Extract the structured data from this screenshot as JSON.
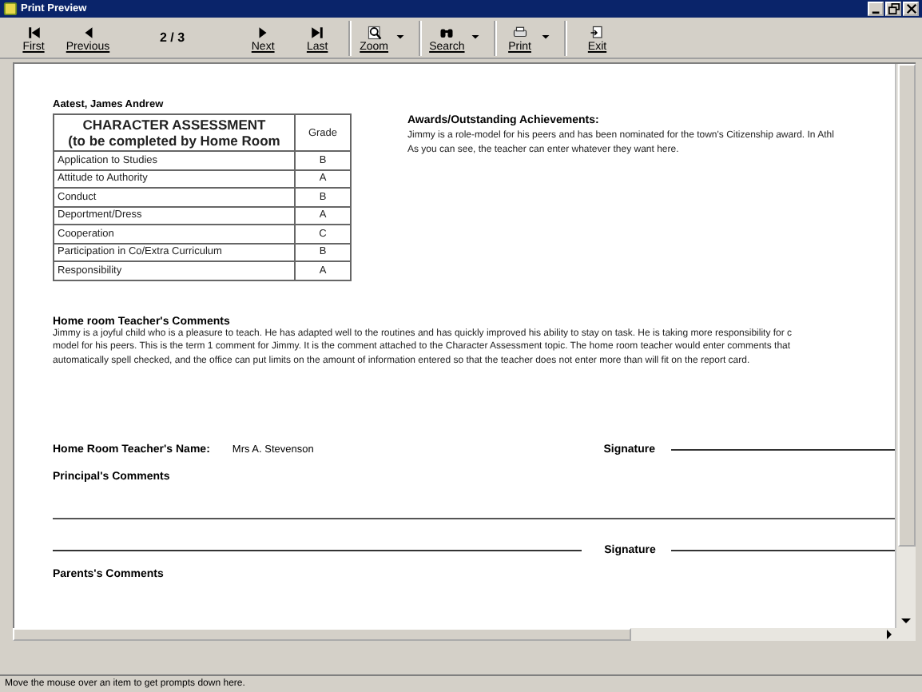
{
  "window": {
    "title": "Print Preview"
  },
  "toolbar": [
    {
      "kind": "first",
      "label": "First"
    },
    {
      "kind": "previous",
      "label": "Previous"
    },
    {
      "kind": "page",
      "label": "2 / 3"
    },
    {
      "kind": "next",
      "label": "Next"
    },
    {
      "kind": "last",
      "label": "Last"
    },
    {
      "kind": "zoom",
      "label": "Zoom"
    },
    {
      "kind": "search",
      "label": "Search"
    },
    {
      "kind": "print",
      "label": "Print"
    },
    {
      "kind": "exit",
      "label": "Exit"
    }
  ],
  "report": {
    "student": "Aatest, James Andrew",
    "assessment": {
      "heading_1": "CHARACTER ASSESSMENT",
      "heading_2": "(to be completed by Home Room",
      "grade_heading": "Grade",
      "rows": [
        {
          "item": "Application to Studies",
          "grade": "B"
        },
        {
          "item": "Attitude to Authority",
          "grade": "A"
        },
        {
          "item": "Conduct",
          "grade": "B"
        },
        {
          "item": "Deportment/Dress",
          "grade": "A"
        },
        {
          "item": "Cooperation",
          "grade": "C"
        },
        {
          "item": "Participation in Co/Extra Curriculum",
          "grade": "B"
        },
        {
          "item": "Responsibility",
          "grade": "A"
        }
      ]
    },
    "awards": {
      "heading": "Awards/Outstanding Achievements:",
      "lines": [
        "Jimmy is a role-model for his peers and has been nominated for the town's Citizenship award.  In Athl",
        "As you can see, the teacher can enter whatever they want here."
      ]
    },
    "teacher_comments": {
      "heading": "Home room Teacher's Comments",
      "lines": [
        "Jimmy is a joyful child who is a pleasure to teach.  He has adapted well to the routines and has quickly improved his ability to stay on task.  He is taking more responsibility for c",
        "model for his peers.  This is the term 1 comment for Jimmy.  It is the comment attached to the Character Assessment topic. The home room teacher would enter comments that",
        "automatically spell checked, and the office can put limits on the amount of information entered so that the teacher does not enter more than will fit on the report card."
      ]
    },
    "teacher_name_label": "Home Room Teacher's Name:",
    "teacher_name": "Mrs A. Stevenson",
    "signature_1": "Signature",
    "principal_heading": "Principal's Comments",
    "signature_2": "Signature",
    "parents_heading": "Parents's Comments"
  },
  "status_bar": "Move the mouse over an item to get prompts down here."
}
